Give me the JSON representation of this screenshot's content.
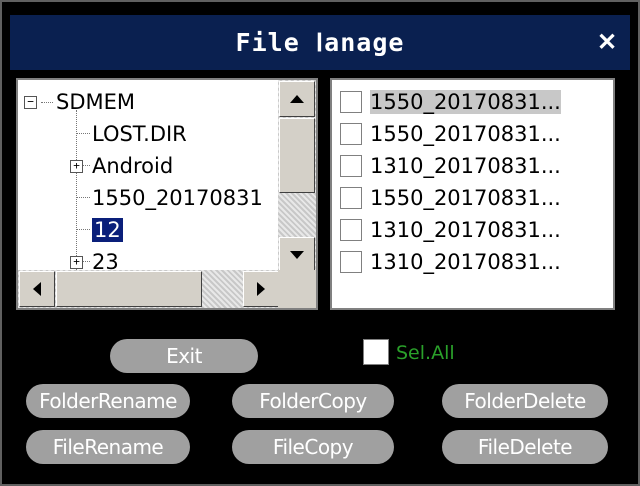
{
  "window": {
    "title": "File Ⅰanage",
    "close_glyph": "✕"
  },
  "tree": {
    "nodes": [
      {
        "label": "SDMEM",
        "expander": "−"
      },
      {
        "label": "LOST.DIR"
      },
      {
        "label": "Android",
        "expander": "+"
      },
      {
        "label": "1550_20170831"
      },
      {
        "label": "12",
        "selected": true
      },
      {
        "label": "23",
        "expander": "+"
      }
    ]
  },
  "files": [
    {
      "name": "1550_20170831...",
      "highlighted": true
    },
    {
      "name": "1550_20170831..."
    },
    {
      "name": "1310_20170831..."
    },
    {
      "name": "1550_20170831..."
    },
    {
      "name": "1310_20170831..."
    },
    {
      "name": "1310_20170831..."
    }
  ],
  "buttons": {
    "exit": "Exit",
    "folder_rename": "FolderRename",
    "folder_copy": "FolderCopy",
    "folder_delete": "FolderDelete",
    "file_rename": "FileRename",
    "file_copy": "FileCopy",
    "file_delete": "FileDelete"
  },
  "select_all": {
    "label": "Sel.All",
    "checked": false
  },
  "colors": {
    "title_bar": "#0a2050",
    "button": "#a0a0a0",
    "select_all_label": "#2aa02a",
    "selection": "#0a1f7a"
  }
}
